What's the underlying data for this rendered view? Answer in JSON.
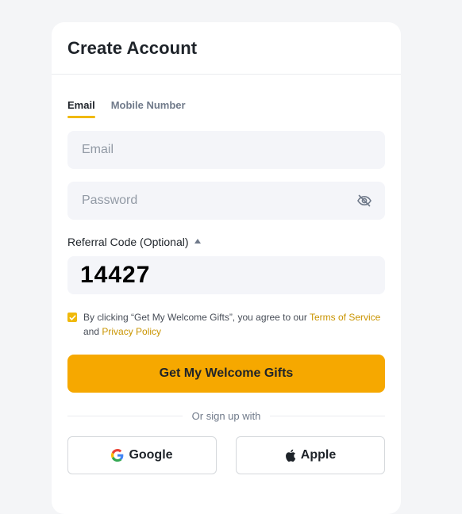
{
  "header": {
    "title": "Create Account"
  },
  "tabs": [
    {
      "label": "Email",
      "active": true
    },
    {
      "label": "Mobile Number",
      "active": false
    }
  ],
  "email": {
    "placeholder": "Email",
    "value": ""
  },
  "password": {
    "placeholder": "Password",
    "value": "",
    "toggle_icon": "eye-slash-icon"
  },
  "referral": {
    "label": "Referral Code (Optional)",
    "value": "14427",
    "expanded": true
  },
  "terms": {
    "checked": true,
    "prefix": "By clicking “Get My Welcome Gifts”, you agree to our",
    "terms_link": "Terms of Service",
    "and": "and",
    "privacy_link": "Privacy Policy"
  },
  "submit": {
    "label": "Get My Welcome Gifts"
  },
  "divider": {
    "text": "Or sign up with"
  },
  "social": {
    "google": {
      "label": "Google",
      "icon": "google-icon"
    },
    "apple": {
      "label": "Apple",
      "icon": "apple-icon"
    }
  },
  "colors": {
    "accent": "#f6a800",
    "link": "#c99400",
    "field_bg": "#f4f5f9"
  }
}
